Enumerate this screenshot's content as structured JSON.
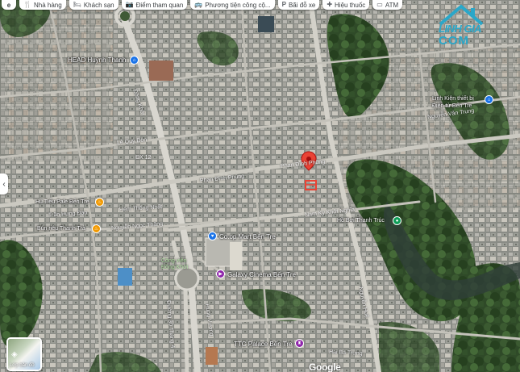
{
  "chips": [
    {
      "label": "e",
      "icon": ""
    },
    {
      "label": "Nhà hàng",
      "icon": "fork-knife-icon"
    },
    {
      "label": "Khách sạn",
      "icon": "bed-icon"
    },
    {
      "label": "Điểm tham quan",
      "icon": "camera-icon"
    },
    {
      "label": "Phương tiện công cộ...",
      "icon": "bus-icon"
    },
    {
      "label": "Bãi đỗ xe",
      "icon": "parking-icon"
    },
    {
      "label": "Hiệu thuốc",
      "icon": "pharmacy-icon"
    },
    {
      "label": "ATM",
      "icon": "atm-icon"
    }
  ],
  "side_arrow": "‹",
  "layer_button": {
    "label": "Lớp bản đồ"
  },
  "google_logo": "Google",
  "watermark": {
    "line1": "LINH GIA",
    "line2": "COM"
  },
  "pois": [
    {
      "name": "HEAD Huỳnh Thanh",
      "color": "#1a73e8"
    },
    {
      "name": "Linh Kiện thiết bị Điện tử Bến Tre",
      "color": "#1a73e8"
    },
    {
      "name": "Hủ Tiếu Pale Bến Tre",
      "color": "#f29900"
    },
    {
      "name": "Bún riêu Thanh Trà",
      "color": "#f29900"
    },
    {
      "name": "Co.op Mart Bến Tre",
      "color": "#1a73e8"
    },
    {
      "name": "Galaxy Cinema Bến Tre",
      "color": "#8e24aa"
    },
    {
      "name": "Hồ Bơi Thanh Trúc",
      "color": "#0f9d58"
    },
    {
      "name": "TTC Palace Bến Tre",
      "color": "#8e24aa"
    }
  ],
  "streets": {
    "dong_khoi": "Đồng Khởi",
    "phan_dinh_phung": "Phan Đình Phùng",
    "nguyen_ngoc_thang": "Nguyễn Ngọc Thăng",
    "nguyen_van_trung": "Nguyễn Văn Trung",
    "hai_ba_trung": "Hai Bà Trưng",
    "nam_ky_khoi_nghia": "Nam Kỳ Khởi Nghĩa",
    "nguyen_hue": "Nguyễn Huệ",
    "hem_thong_nhat": "Hẻm Thống Nhất",
    "duong_30_4": "Đường 30 Tháng 4",
    "tran_hung_dao": "Trần Hưng Đạo",
    "pham_ngoc_thao": "Phạm Ngọc Thảo",
    "hem_nguyen": "Hẻm Nguyễn",
    "cong_vien": "Công viên Đồng Khởi",
    "dx12": "ĐX 12",
    "le_quy_don": "Lê Quý Đôn",
    "hung_vuong": "Hùng Vương"
  }
}
